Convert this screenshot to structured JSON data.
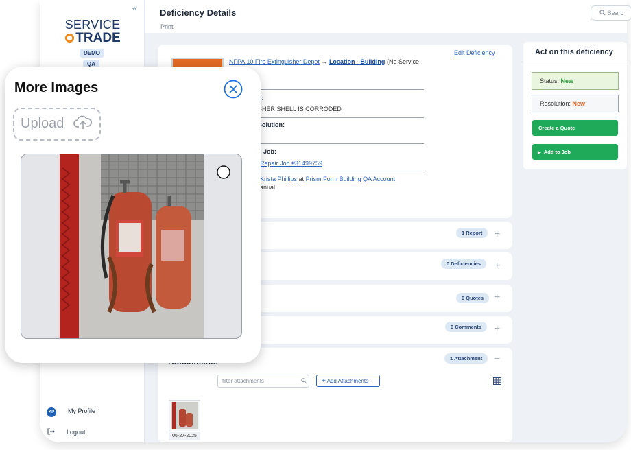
{
  "sidebar": {
    "collapse_glyph": "«",
    "logo_top": "SERVICE",
    "logo_bottom_prefix": "",
    "logo_bottom": "TRADE",
    "badges": [
      "DEMO",
      "QA"
    ],
    "profile_initials": "KP",
    "profile_label": "My Profile",
    "logout_label": "Logout"
  },
  "header": {
    "title": "Deficiency Details",
    "print": "Print",
    "search_placeholder": "Searc"
  },
  "deficiency": {
    "edit": "Edit Deficiency",
    "service_link": "NFPA 10 Fire Extinguisher Depot",
    "arrow": "→",
    "location_link": "Location - Building",
    "location_suffix": "(No Service",
    "description_label": "n:",
    "description_value": "SHER SHELL IS CORRODED",
    "solution_label": "Solution:",
    "job_label": "d Job:",
    "job_link": "Repair Job #31499759",
    "reporter_link": "Krista Phillips",
    "at_word": "at",
    "account_link": "Prism Form Building QA Account",
    "source": "anual"
  },
  "sections": [
    {
      "badge": "1 Report",
      "toggle": "+"
    },
    {
      "badge": "0 Deficiencies",
      "toggle": "+"
    },
    {
      "badge": "0 Quotes",
      "toggle": "+"
    },
    {
      "badge": "0 Comments",
      "toggle": "+"
    }
  ],
  "attachments": {
    "title": "Attachments",
    "badge": "1 Attachment",
    "toggle": "−",
    "filter_placeholder": "filter attachments",
    "add_label": "Add Attachments",
    "thumb_date": "06-27-2025"
  },
  "act_panel": {
    "title": "Act on this deficiency",
    "status_label": "Status:",
    "status_value": "New",
    "resolution_label": "Resolution:",
    "resolution_value": "New",
    "create_quote": "Create a Quote",
    "add_to_job": "Add to Job",
    "colors": {
      "status_new": "#2e9a3c",
      "resolution_new": "#e8682a",
      "action_button": "#1faa5a"
    }
  },
  "modal": {
    "title": "More Images",
    "upload_label": "Upload"
  }
}
